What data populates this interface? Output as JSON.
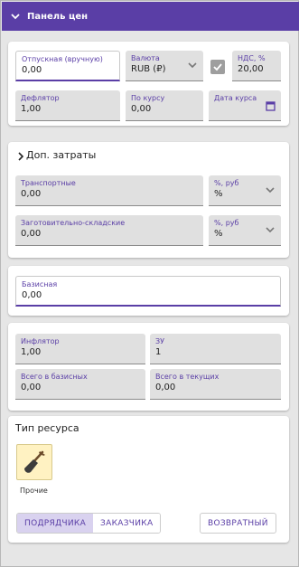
{
  "header": {
    "title": "Панель цен"
  },
  "prices": {
    "manual_price": {
      "label": "Отпускная (вручную)",
      "value": "0,00"
    },
    "currency": {
      "label": "Валюта",
      "value": "RUB (₽)"
    },
    "vat": {
      "label": "НДС, %",
      "value": "20,00",
      "checked": true
    },
    "deflator": {
      "label": "Дефлятор",
      "value": "1,00"
    },
    "by_rate": {
      "label": "По курсу",
      "value": "0,00"
    },
    "rate_date": {
      "label": "Дата курса",
      "value": ""
    }
  },
  "extra_costs": {
    "title": "Доп. затраты",
    "transport": {
      "label": "Транспортные",
      "value": "0,00"
    },
    "transport_unit": {
      "label": "%, руб",
      "value": "%"
    },
    "warehouse": {
      "label": "Заготовительно-складские",
      "value": "0,00"
    },
    "warehouse_unit": {
      "label": "%, руб",
      "value": "%"
    }
  },
  "base": {
    "label": "Базисная",
    "value": "0,00"
  },
  "indices": {
    "inflator": {
      "label": "Инфлятор",
      "value": "1,00"
    },
    "zu": {
      "label": "ЗУ",
      "value": "1"
    },
    "total_base": {
      "label": "Всего в базисных",
      "value": "0,00"
    },
    "total_current": {
      "label": "Всего в текущих",
      "value": "0,00"
    }
  },
  "resource": {
    "title": "Тип ресурса",
    "tile_label": "Прочие",
    "tile_icon": "shovel-icon",
    "toggle": [
      "ПОДРЯДЧИКА",
      "ЗАКАЗЧИКА"
    ],
    "toggle_selected": "ПОДРЯДЧИКА",
    "return_label": "ВОЗВРАТНЫЙ"
  },
  "colors": {
    "accent": "#5a3ea6",
    "field_bg": "#e0e0e0",
    "tile_bg": "#fff2c2"
  }
}
